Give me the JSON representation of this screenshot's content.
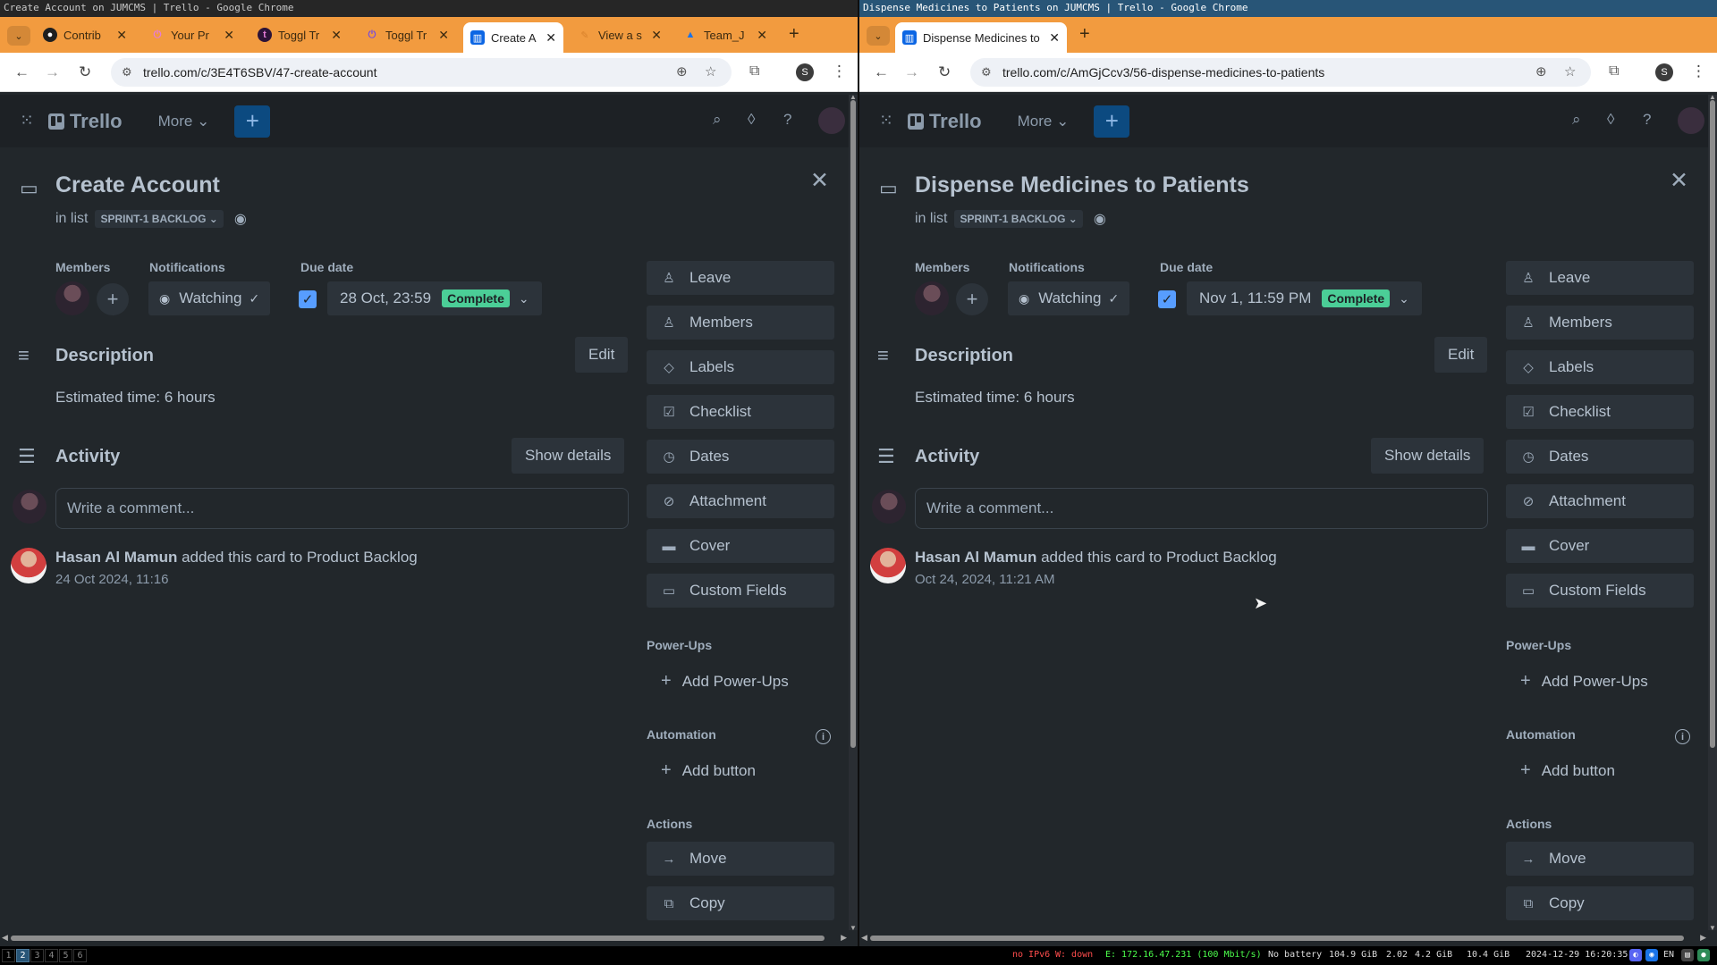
{
  "left_window": {
    "title_bar": "Create Account on JUMCMS | Trello - Google Chrome",
    "tabs": [
      {
        "label": "Contrib",
        "icon": "github-icon"
      },
      {
        "label": "Your Pr",
        "icon": "toggl-icon"
      },
      {
        "label": "Toggl Tr",
        "icon": "toggl-t-icon"
      },
      {
        "label": "Toggl Tr",
        "icon": "toggl-icon"
      },
      {
        "label": "Create A",
        "icon": "trello-icon",
        "active": true
      },
      {
        "label": "View a s",
        "icon": "generic-icon"
      },
      {
        "label": "Team_J",
        "icon": "drive-icon"
      }
    ],
    "url": "trello.com/c/3E4T6SBV/47-create-account",
    "profile_initial": "S",
    "header": {
      "logo": "Trello",
      "more": "More"
    },
    "card": {
      "title": "Create Account",
      "in_list_prefix": "in list",
      "list_name": "SPRINT-1 BACKLOG",
      "members_label": "Members",
      "notifications_label": "Notifications",
      "watching_label": "Watching",
      "due_label": "Due date",
      "due_value": "28 Oct, 23:59",
      "due_badge": "Complete",
      "description_title": "Description",
      "edit_label": "Edit",
      "description_text": "Estimated time: 6 hours",
      "activity_title": "Activity",
      "show_details_label": "Show details",
      "comment_placeholder": "Write a comment...",
      "activity_user": "Hasan Al Mamun",
      "activity_text": "added this card to Product Backlog",
      "activity_time": "24 Oct 2024, 11:16"
    }
  },
  "right_window": {
    "title_bar": "Dispense Medicines to Patients on JUMCMS | Trello - Google Chrome",
    "tabs": [
      {
        "label": "Dispense Medicines to Patie",
        "icon": "trello-icon",
        "active": true
      }
    ],
    "url": "trello.com/c/AmGjCcv3/56-dispense-medicines-to-patients",
    "profile_initial": "S",
    "header": {
      "logo": "Trello",
      "more": "More"
    },
    "card": {
      "title": "Dispense Medicines to Patients",
      "in_list_prefix": "in list",
      "list_name": "SPRINT-1 BACKLOG",
      "members_label": "Members",
      "notifications_label": "Notifications",
      "watching_label": "Watching",
      "due_label": "Due date",
      "due_value": "Nov 1, 11:59 PM",
      "due_badge": "Complete",
      "description_title": "Description",
      "edit_label": "Edit",
      "description_text": "Estimated time: 6 hours",
      "activity_title": "Activity",
      "show_details_label": "Show details",
      "comment_placeholder": "Write a comment...",
      "activity_user": "Hasan Al Mamun",
      "activity_text": "added this card to Product Backlog",
      "activity_time": "Oct 24, 2024, 11:21 AM"
    }
  },
  "sidebar": {
    "buttons": [
      {
        "label": "Leave",
        "icon": "person-icon"
      },
      {
        "label": "Members",
        "icon": "person-icon"
      },
      {
        "label": "Labels",
        "icon": "tag-icon"
      },
      {
        "label": "Checklist",
        "icon": "checklist-icon"
      },
      {
        "label": "Dates",
        "icon": "clock-icon"
      },
      {
        "label": "Attachment",
        "icon": "paperclip-icon"
      },
      {
        "label": "Cover",
        "icon": "cover-icon"
      },
      {
        "label": "Custom Fields",
        "icon": "custom-fields-icon"
      }
    ],
    "powerups_label": "Power-Ups",
    "add_powerups": "Add Power-Ups",
    "automation_label": "Automation",
    "add_button": "Add button",
    "actions_label": "Actions",
    "move": "Move",
    "copy": "Copy"
  },
  "statusbar": {
    "workspaces": [
      "1",
      "2",
      "3",
      "4",
      "5",
      "6"
    ],
    "active_workspace": "2",
    "ipv6": "no IPv6",
    "wifi": "W: down",
    "ethernet": "E: 172.16.47.231 (100 Mbit/s)",
    "battery": "No battery",
    "disk": "104.9 GiB",
    "load": "2.02",
    "mem": "4.2 GiB",
    "swap": "10.4 GiB",
    "datetime": "2024-12-29 16:20:35",
    "lang": "EN",
    "colors": {
      "warn": "#ff4d4d",
      "ok": "#4cff4c"
    }
  },
  "colors": {
    "accent": "#579dff",
    "complete": "#4bce97",
    "tabbar": "#f29b3f",
    "card_bg": "#22272b"
  }
}
